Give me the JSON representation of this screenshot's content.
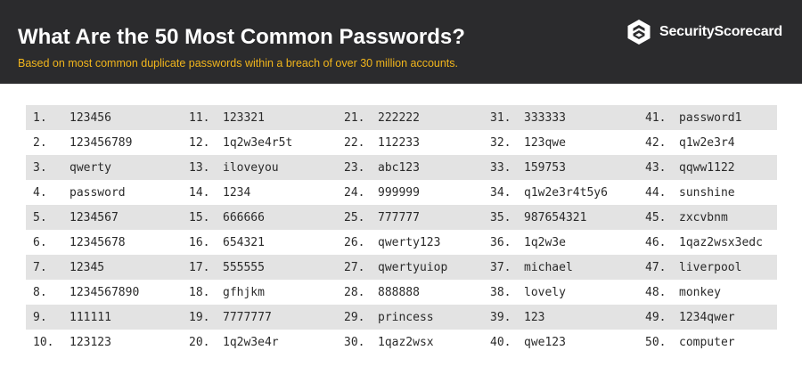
{
  "header": {
    "title": "What Are the 50 Most Common Passwords?",
    "subtitle": "Based on most common duplicate passwords within a breach of over 30 million accounts.",
    "brand": "SecurityScorecard",
    "background_color": "#2b2b2d",
    "subtitle_color": "#f2b61c"
  },
  "table": {
    "shaded_color": "#e3e3e3",
    "rows": [
      [
        {
          "num": "1.",
          "pw": "123456"
        },
        {
          "num": "11.",
          "pw": "123321"
        },
        {
          "num": "21.",
          "pw": "222222"
        },
        {
          "num": "31.",
          "pw": "333333"
        },
        {
          "num": "41.",
          "pw": "password1"
        }
      ],
      [
        {
          "num": "2.",
          "pw": "123456789"
        },
        {
          "num": "12.",
          "pw": "1q2w3e4r5t"
        },
        {
          "num": "22.",
          "pw": "112233"
        },
        {
          "num": "32.",
          "pw": "123qwe"
        },
        {
          "num": "42.",
          "pw": "q1w2e3r4"
        }
      ],
      [
        {
          "num": "3.",
          "pw": "qwerty"
        },
        {
          "num": "13.",
          "pw": "iloveyou"
        },
        {
          "num": "23.",
          "pw": "abc123"
        },
        {
          "num": "33.",
          "pw": "159753"
        },
        {
          "num": "43.",
          "pw": "qqww1122"
        }
      ],
      [
        {
          "num": "4.",
          "pw": "password"
        },
        {
          "num": "14.",
          "pw": "1234"
        },
        {
          "num": "24.",
          "pw": "999999"
        },
        {
          "num": "34.",
          "pw": "q1w2e3r4t5y6"
        },
        {
          "num": "44.",
          "pw": "sunshine"
        }
      ],
      [
        {
          "num": "5.",
          "pw": "1234567"
        },
        {
          "num": "15.",
          "pw": "666666"
        },
        {
          "num": "25.",
          "pw": "777777"
        },
        {
          "num": "35.",
          "pw": "987654321"
        },
        {
          "num": "45.",
          "pw": "zxcvbnm"
        }
      ],
      [
        {
          "num": "6.",
          "pw": "12345678"
        },
        {
          "num": "16.",
          "pw": "654321"
        },
        {
          "num": "26.",
          "pw": "qwerty123"
        },
        {
          "num": "36.",
          "pw": "1q2w3e"
        },
        {
          "num": "46.",
          "pw": "1qaz2wsx3edc"
        }
      ],
      [
        {
          "num": "7.",
          "pw": "12345"
        },
        {
          "num": "17.",
          "pw": "555555"
        },
        {
          "num": "27.",
          "pw": "qwertyuiop"
        },
        {
          "num": "37.",
          "pw": "michael"
        },
        {
          "num": "47.",
          "pw": "liverpool"
        }
      ],
      [
        {
          "num": "8.",
          "pw": "1234567890"
        },
        {
          "num": "18.",
          "pw": "gfhjkm"
        },
        {
          "num": "28.",
          "pw": "888888"
        },
        {
          "num": "38.",
          "pw": "lovely"
        },
        {
          "num": "48.",
          "pw": "monkey"
        }
      ],
      [
        {
          "num": "9.",
          "pw": "111111"
        },
        {
          "num": "19.",
          "pw": "7777777"
        },
        {
          "num": "29.",
          "pw": "princess"
        },
        {
          "num": "39.",
          "pw": "123"
        },
        {
          "num": "49.",
          "pw": "1234qwer"
        }
      ],
      [
        {
          "num": "10.",
          "pw": "123123"
        },
        {
          "num": "20.",
          "pw": "1q2w3e4r"
        },
        {
          "num": "30.",
          "pw": "1qaz2wsx"
        },
        {
          "num": "40.",
          "pw": "qwe123"
        },
        {
          "num": "50.",
          "pw": "computer"
        }
      ]
    ]
  }
}
